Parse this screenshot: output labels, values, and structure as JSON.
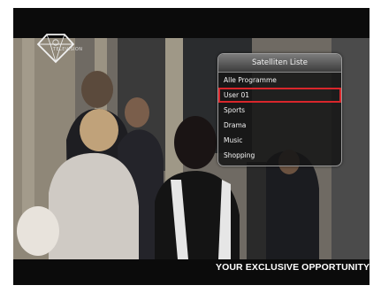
{
  "channel_logo": {
    "icon": "diamond-logo-icon",
    "label": "TELEVISION"
  },
  "satellite_list": {
    "title": "Satelliten Liste",
    "items": [
      {
        "label": "Alle Programme",
        "selected": false
      },
      {
        "label": "User 01",
        "selected": true
      },
      {
        "label": "Sports",
        "selected": false
      },
      {
        "label": "Drama",
        "selected": false
      },
      {
        "label": "Music",
        "selected": false
      },
      {
        "label": "Shopping",
        "selected": false
      }
    ],
    "highlight_color": "#d9262b"
  },
  "ticker": {
    "text": "YOUR EXCLUSIVE OPPORTUNITY T"
  }
}
